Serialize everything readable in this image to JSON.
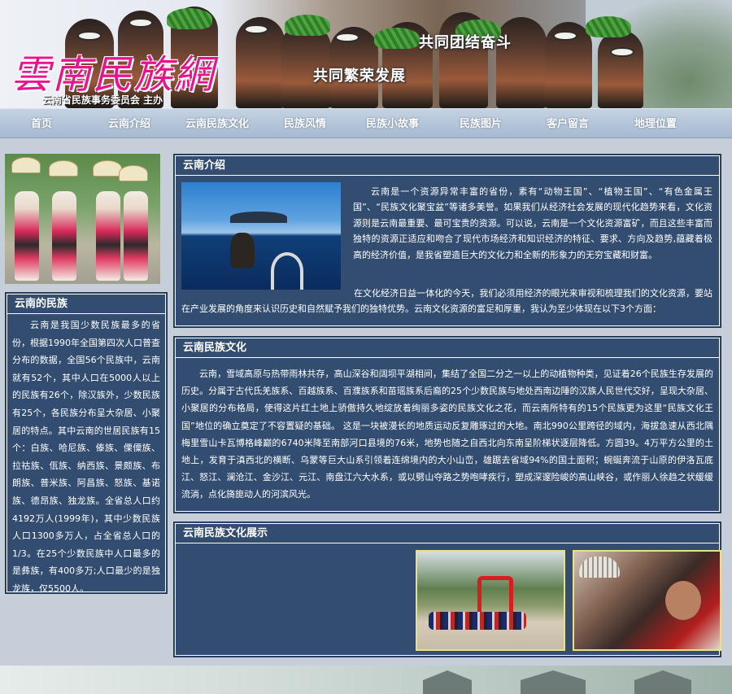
{
  "banner": {
    "logo": "雲南民族網",
    "host": "云南省民族事务委员会 主办",
    "slogan_1": "共同团结奋斗",
    "slogan_2": "共同繁荣发展"
  },
  "nav": {
    "items": [
      {
        "label": "首页"
      },
      {
        "label": "云南介绍"
      },
      {
        "label": "云南民族文化"
      },
      {
        "label": "民族风情"
      },
      {
        "label": "民族小故事"
      },
      {
        "label": "民族图片"
      },
      {
        "label": "客户留言"
      },
      {
        "label": "地理位置"
      }
    ]
  },
  "sidebar": {
    "ethnic": {
      "title": "云南的民族",
      "text": "云南是我国少数民族最多的省份，根据1990年全国第四次人口普查分布的数据，全国56个民族中，云南就有52个，其中人口在5000人以上的民族有26个，除汉族外，少数民族有25个，各民族分布呈大杂居、小聚居的特点。其中云南的世居民族有15个：白族、哈尼族、傣族、傈僳族、拉祜族、佤族、纳西族、景颇族、布朗族、普米族、阿昌族、怒族、基诺族、德昂族、独龙族。全省总人口约4192万人(1999年)，其中少数民族人口1300多万人，占全省总人口的1/3。在25个少数民族中人口最多的是彝族，有400多万;人口最少的是独龙族，仅5500人。"
    }
  },
  "main": {
    "intro": {
      "title": "云南介绍",
      "p1": "云南是一个资源异常丰富的省份，素有“动物王国”、“植物王国”、“有色金属王国”、“民族文化聚宝盆”等诸多美誉。如果我们从经济社会发展的现代化趋势来看，文化资源则是云南最重要、最可宝贵的资源。可以说，云南是一个文化资源富矿，而且这些丰富而独特的资源正适应和吻合了现代市场经济和知识经济的特征、要求、方向及趋势,蕴藏着极高的经济价值，是我省塑造巨大的文化力和全新的形象力的无穷宝藏和财富。",
      "p2": "在文化经济日益一体化的今天，我们必须用经济的眼光来审视和梳理我们的文化资源，要站在产业发展的角度来认识历史和自然赋予我们的独特优势。云南文化资源的富足和厚重，我认为至少体现在以下3个方面："
    },
    "culture": {
      "title": "云南民族文化",
      "text": "云南，雪域高原与热带雨林共存，高山深谷和阔坝平湖相间，集结了全国二分之一以上的动植物种类，见证着26个民族生存发展的历史。分属于古代氐羌族系、百越族系、百濮族系和苗瑶族系后裔的25个少数民族与地处西南边陲的汉族人民世代交好，呈现大杂居、小聚居的分布格局，使得这片红土地上骄傲持久地绽放着绚丽多姿的民族文化之花，而云南所特有的15个民族更为这里“民族文化王国”地位的确立奠定了不容置疑的基础。 这是一块被漫长的地质运动反复雕琢过的大地。南北990公里跨径的域内，海拔急速从西北隅梅里雪山卡瓦博格峰巅的6740米降至南部河口县境的76米，地势也随之自西北向东南呈阶梯状逐层降低。方圆39。4万平方公里的土地上，发育于滇西北的横断、乌蒙等巨大山系引领着连绵境内的大小山峦，雄踞去省域94%的国土面积；蜿蜒奔流于山原的伊洛瓦底江、怒江、澜沧江、金沙江、元江、南盘江六大水系，或以劈山夺路之势咆哮疾行，塑成深邃险峻的高山峡谷，或作丽人徐趋之状缓缓流淌，点化旖旎动人的河滨风光。"
    },
    "showcase": {
      "title": "云南民族文化展示"
    }
  }
}
